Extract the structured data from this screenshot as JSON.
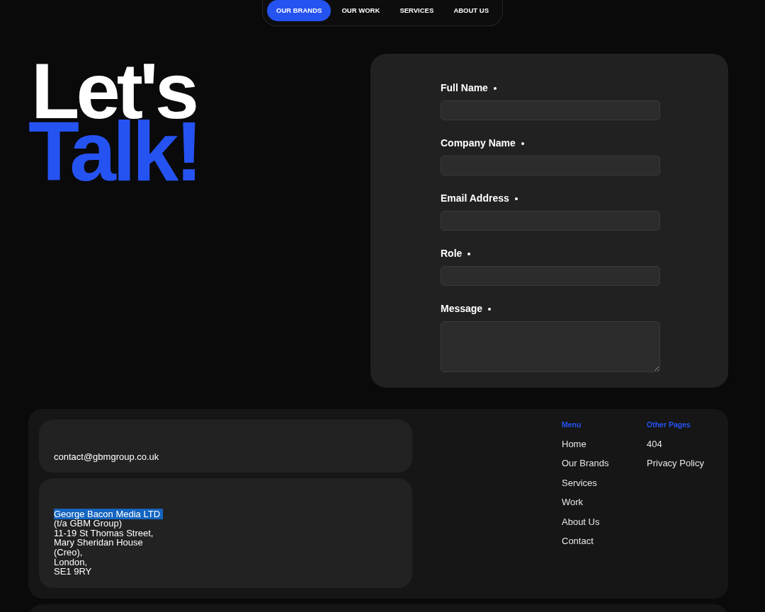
{
  "nav": [
    {
      "label": "OUR BRANDS",
      "selected": true
    },
    {
      "label": "OUR WORK",
      "selected": false
    },
    {
      "label": "SERVICES",
      "selected": false
    },
    {
      "label": "ABOUT US",
      "selected": false
    }
  ],
  "hero": {
    "line_1": "Let's",
    "line_2": "Talk!"
  },
  "form": {
    "fields": [
      {
        "label": "Full Name",
        "required": true,
        "kind": "input"
      },
      {
        "label": "Company Name",
        "required": true,
        "kind": "input"
      },
      {
        "label": "Email Address",
        "required": true,
        "kind": "input"
      },
      {
        "label": "Role",
        "required": true,
        "kind": "input"
      },
      {
        "label": "Message",
        "required": true,
        "kind": "textarea"
      }
    ]
  },
  "footer": {
    "email": "contact@gbmgroup.co.uk",
    "address": [
      {
        "text": "George Bacon Media LTD",
        "highlighted": true
      },
      {
        "text": "(t/a GBM Group)",
        "highlighted": false
      },
      {
        "text": "11-19 St Thomas Street,",
        "highlighted": false
      },
      {
        "text": "Mary Sheridan House",
        "highlighted": false
      },
      {
        "text": "(Creo),",
        "highlighted": false
      },
      {
        "text": "London,",
        "highlighted": false
      },
      {
        "text": "SE1 9RY",
        "highlighted": false
      }
    ],
    "columns": [
      {
        "heading": "Menu",
        "links": [
          "Home",
          "Our Brands",
          "Services",
          "Work",
          "About Us",
          "Contact"
        ]
      },
      {
        "heading": "Other Pages",
        "links": [
          "404",
          "Privacy Policy"
        ]
      }
    ]
  }
}
